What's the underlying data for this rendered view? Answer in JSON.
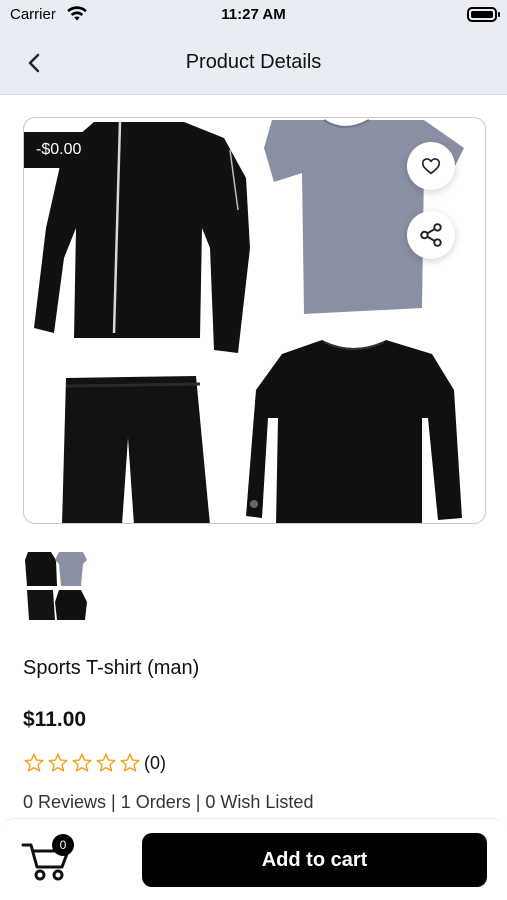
{
  "status_bar": {
    "carrier": "Carrier",
    "time": "11:27 AM"
  },
  "nav": {
    "title": "Product Details"
  },
  "product": {
    "discount_badge": "-$0.00",
    "name": "Sports T-shirt (man)",
    "price": "$11.00",
    "rating": 0,
    "rating_max": 5,
    "rating_count": "(0)",
    "stats": "0 Reviews | 1 Orders | 0 Wish Listed"
  },
  "cart": {
    "badge_count": "0",
    "add_to_cart_label": "Add to cart"
  },
  "colors": {
    "accent": "#000000",
    "star_outline": "#f0a21a",
    "header_bg": "#e9ecf3"
  },
  "icons": {
    "back": "chevron-left-icon",
    "wishlist": "heart-icon",
    "share": "share-icon",
    "cart": "cart-icon",
    "star": "star-outline-icon"
  }
}
